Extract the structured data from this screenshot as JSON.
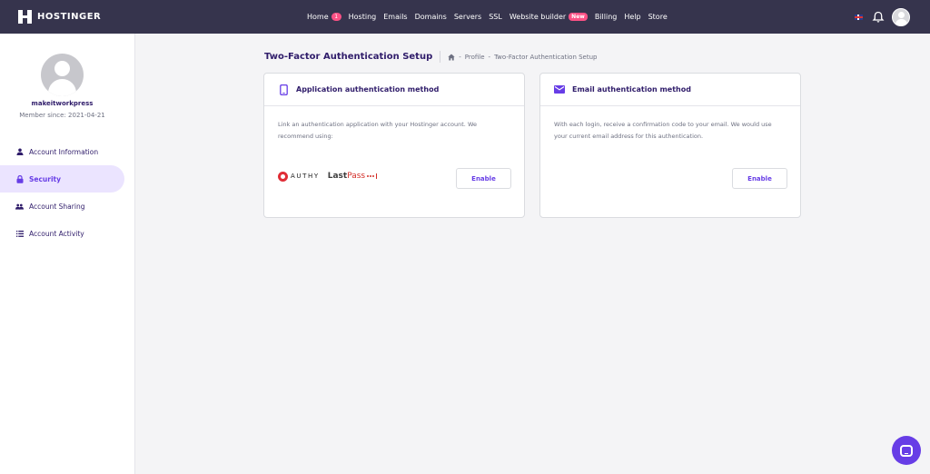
{
  "brand": {
    "name": "HOSTINGER"
  },
  "nav": {
    "items": [
      {
        "label": "Home",
        "badge": "1"
      },
      {
        "label": "Hosting"
      },
      {
        "label": "Emails"
      },
      {
        "label": "Domains"
      },
      {
        "label": "Servers"
      },
      {
        "label": "SSL"
      },
      {
        "label": "Website builder",
        "badge": "New"
      },
      {
        "label": "Billing"
      },
      {
        "label": "Help"
      },
      {
        "label": "Store"
      }
    ]
  },
  "profile": {
    "username": "makeitworkpress",
    "member_since": "Member since: 2021-04-21"
  },
  "sidebar": {
    "items": [
      {
        "label": "Account Information",
        "icon": "person-icon",
        "active": false
      },
      {
        "label": "Security",
        "icon": "lock-icon",
        "active": true
      },
      {
        "label": "Account Sharing",
        "icon": "group-icon",
        "active": false
      },
      {
        "label": "Account Activity",
        "icon": "list-icon",
        "active": false
      }
    ]
  },
  "page": {
    "title": "Two-Factor Authentication Setup",
    "breadcrumb": [
      "Profile",
      "Two-Factor Authentication Setup"
    ]
  },
  "cards": [
    {
      "title": "Application authentication method",
      "icon": "phone-icon",
      "description": "Link an authentication application with your Hostinger account. We recommend using:",
      "logos": {
        "authy": "AUTHY",
        "lastpass_last": "Last",
        "lastpass_pass": "Pass"
      },
      "button": "Enable"
    },
    {
      "title": "Email authentication method",
      "icon": "mail-icon",
      "description": "With each login, receive a confirmation code to your email. We would use your current email address for this authentication.",
      "button": "Enable"
    }
  ],
  "colors": {
    "topbar": "#36344d",
    "accent": "#673de6",
    "badge": "#fc5185",
    "active_bg": "#ebe4ff"
  }
}
